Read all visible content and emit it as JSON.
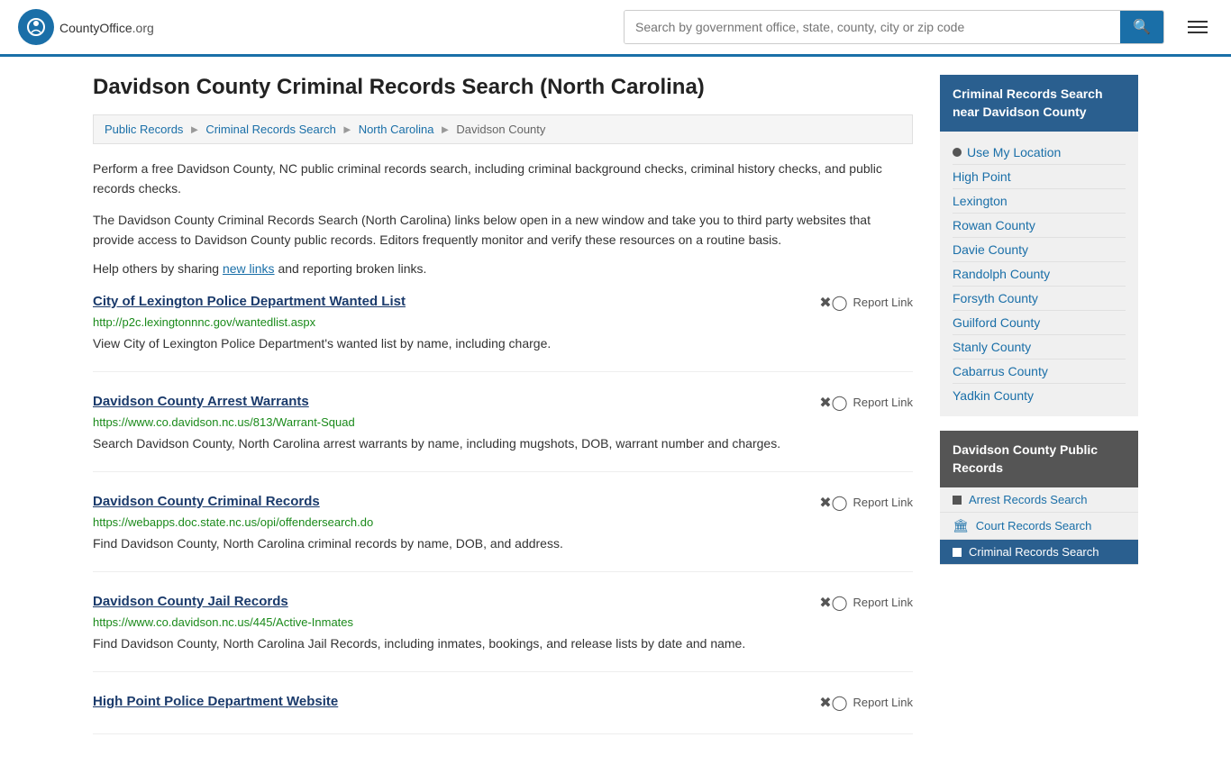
{
  "header": {
    "logo_text": "CountyOffice",
    "logo_suffix": ".org",
    "search_placeholder": "Search by government office, state, county, city or zip code"
  },
  "page": {
    "title": "Davidson County Criminal Records Search (North Carolina)"
  },
  "breadcrumb": {
    "items": [
      "Public Records",
      "Criminal Records Search",
      "North Carolina",
      "Davidson County"
    ]
  },
  "description": {
    "para1": "Perform a free Davidson County, NC public criminal records search, including criminal background checks, criminal history checks, and public records checks.",
    "para2": "The Davidson County Criminal Records Search (North Carolina) links below open in a new window and take you to third party websites that provide access to Davidson County public records. Editors frequently monitor and verify these resources on a routine basis.",
    "help_prefix": "Help others by sharing ",
    "help_link": "new links",
    "help_suffix": " and reporting broken links."
  },
  "results": [
    {
      "title": "City of Lexington Police Department Wanted List",
      "url": "http://p2c.lexingtonnnc.gov/wantedlist.aspx",
      "description": "View City of Lexington Police Department's wanted list by name, including charge.",
      "report_label": "Report Link"
    },
    {
      "title": "Davidson County Arrest Warrants",
      "url": "https://www.co.davidson.nc.us/813/Warrant-Squad",
      "description": "Search Davidson County, North Carolina arrest warrants by name, including mugshots, DOB, warrant number and charges.",
      "report_label": "Report Link"
    },
    {
      "title": "Davidson County Criminal Records",
      "url": "https://webapps.doc.state.nc.us/opi/offendersearch.do",
      "description": "Find Davidson County, North Carolina criminal records by name, DOB, and address.",
      "report_label": "Report Link"
    },
    {
      "title": "Davidson County Jail Records",
      "url": "https://www.co.davidson.nc.us/445/Active-Inmates",
      "description": "Find Davidson County, North Carolina Jail Records, including inmates, bookings, and release lists by date and name.",
      "report_label": "Report Link"
    },
    {
      "title": "High Point Police Department Website",
      "url": "",
      "description": "",
      "report_label": "Report Link"
    }
  ],
  "sidebar": {
    "criminal_header": "Criminal Records Search near Davidson County",
    "use_location": "Use My Location",
    "nearby_links": [
      "High Point",
      "Lexington",
      "Rowan County",
      "Davie County",
      "Randolph County",
      "Forsyth County",
      "Guilford County",
      "Stanly County",
      "Cabarrus County",
      "Yadkin County"
    ],
    "public_records_header": "Davidson County Public Records",
    "public_links": [
      {
        "label": "Arrest Records Search",
        "active": false
      },
      {
        "label": "Court Records Search",
        "active": false
      },
      {
        "label": "Criminal Records Search",
        "active": true
      }
    ]
  }
}
